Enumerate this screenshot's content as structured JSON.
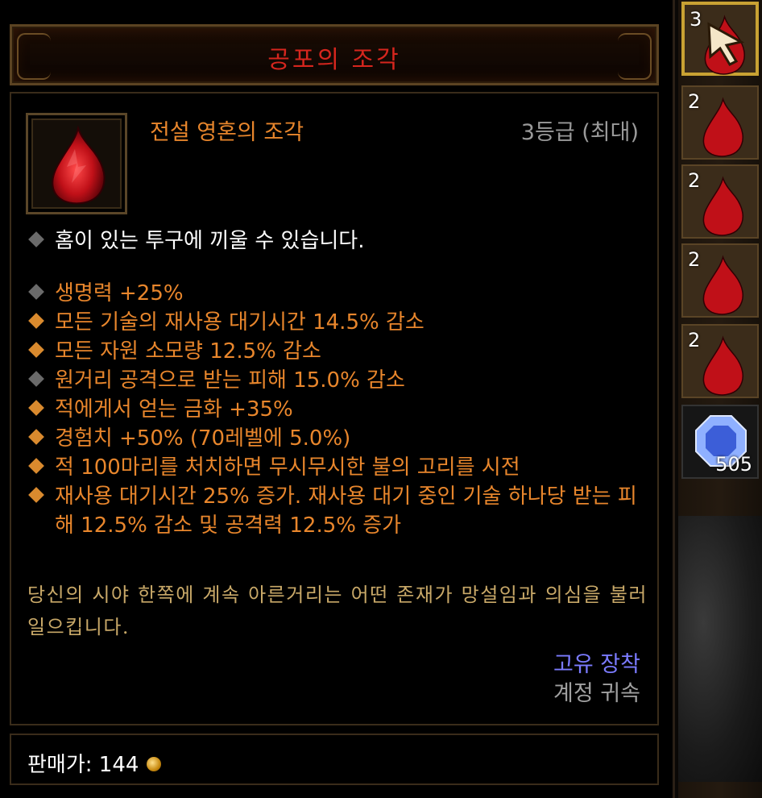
{
  "tooltip": {
    "title": "공포의 조각",
    "item_type": "전설 영혼의 조각",
    "rank": "3등급 (최대)",
    "socket_text": "홈이 있는 투구에 끼울 수 있습니다.",
    "affixes": [
      {
        "text": "생명력 +25%",
        "bullet": "grey"
      },
      {
        "text": "모든 기술의 재사용 대기시간 14.5% 감소",
        "bullet": "orange"
      },
      {
        "text": "모든 자원 소모량 12.5% 감소",
        "bullet": "orange"
      },
      {
        "text": "원거리 공격으로 받는 피해 15.0% 감소",
        "bullet": "grey"
      },
      {
        "text": "적에게서 얻는 금화 +35%",
        "bullet": "orange"
      },
      {
        "text": "경험치 +50% (70레벨에 5.0%)",
        "bullet": "orange"
      },
      {
        "text": "적 100마리를 처치하면 무시무시한 불의 고리를 시전",
        "bullet": "orange"
      },
      {
        "text": "재사용 대기시간 25% 증가. 재사용 대기 중인 기술 하나당 받는 피해 12.5% 감소 및 공격력 12.5% 증가",
        "bullet": "orange"
      }
    ],
    "flavor_text": "당신의 시야 한쪽에 계속 아른거리는 어떤 존재가 망설임과 의심을 불러일으킵니다.",
    "unique_equip": "고유 장착",
    "account_bound": "계정 귀속",
    "price_label": "판매가:",
    "price_value": "144"
  },
  "inventory": {
    "slots": [
      {
        "count": "3",
        "selected": true
      },
      {
        "count": "2"
      },
      {
        "count": "2"
      },
      {
        "count": "2"
      },
      {
        "count": "2"
      }
    ],
    "gem_count": "505"
  },
  "colors": {
    "title": "#d6261e",
    "legendary": "#e8862c",
    "unique": "#7b7bff",
    "flavor": "#c8a868"
  },
  "icons": [
    "shard-icon",
    "gem-icon",
    "gold-coin-icon",
    "cursor-icon"
  ]
}
